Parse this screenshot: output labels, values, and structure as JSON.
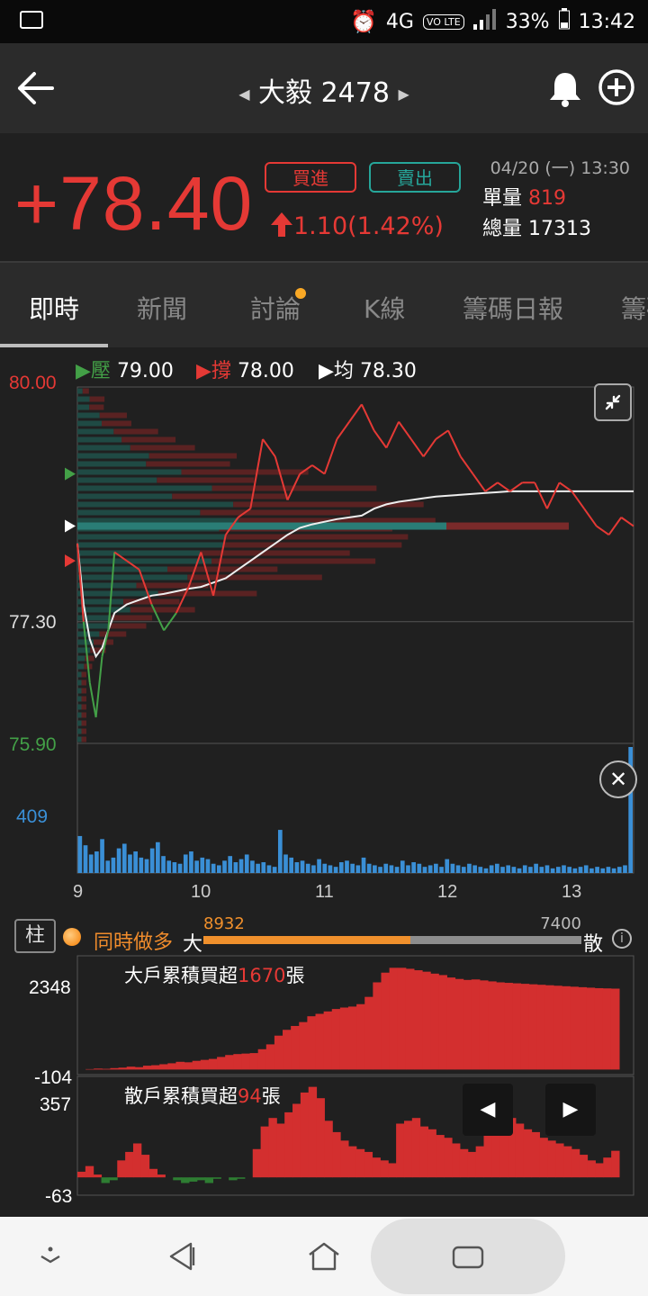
{
  "status_bar": {
    "network": "4G",
    "volte": "VO LTE",
    "battery": "33%",
    "time": "13:42"
  },
  "header": {
    "stock_name": "大毅 2478"
  },
  "quote": {
    "price": "78.40",
    "sign": "+",
    "buy_label": "買進",
    "sell_label": "賣出",
    "change": "1.10(1.42%)",
    "datetime": "04/20 (一) 13:30",
    "single_vol_label": "單量",
    "single_vol": "819",
    "total_vol_label": "總量",
    "total_vol": "17313"
  },
  "tabs": [
    {
      "label": "即時",
      "active": true
    },
    {
      "label": "新聞"
    },
    {
      "label": "討論",
      "has_dot": true
    },
    {
      "label": "K線"
    },
    {
      "label": "籌碼日報"
    },
    {
      "label": "籌碼"
    }
  ],
  "chart_legend": {
    "resist_label": "壓",
    "resist_value": "79.00",
    "support_label": "撐",
    "support_value": "78.00",
    "avg_label": "均",
    "avg_value": "78.30"
  },
  "chart_data": [
    {
      "type": "line",
      "y_top_label": "80.00",
      "y_mid_label": "77.30",
      "y_bottom_label": "75.90",
      "ylim": [
        75.9,
        80.0
      ],
      "x_tick_labels": [
        "9",
        "10",
        "11",
        "12",
        "13"
      ],
      "price_series_x": [
        9.0,
        9.05,
        9.1,
        9.15,
        9.2,
        9.25,
        9.3,
        9.4,
        9.5,
        9.6,
        9.7,
        9.8,
        9.9,
        10.0,
        10.1,
        10.2,
        10.3,
        10.4,
        10.5,
        10.6,
        10.7,
        10.8,
        10.9,
        11.0,
        11.1,
        11.2,
        11.3,
        11.4,
        11.5,
        11.6,
        11.7,
        11.8,
        11.9,
        12.0,
        12.1,
        12.2,
        12.3,
        12.4,
        12.5,
        12.6,
        12.7,
        12.8,
        12.9,
        13.0,
        13.1,
        13.2,
        13.3,
        13.4,
        13.5
      ],
      "price_series_y": [
        78.2,
        77.3,
        76.6,
        76.2,
        76.9,
        77.2,
        78.1,
        78.0,
        77.9,
        77.5,
        77.2,
        77.4,
        77.7,
        78.1,
        77.6,
        78.3,
        78.5,
        78.6,
        79.4,
        79.2,
        78.7,
        79.0,
        79.1,
        79.0,
        79.4,
        79.6,
        79.8,
        79.5,
        79.3,
        79.6,
        79.4,
        79.2,
        79.4,
        79.5,
        79.2,
        79.0,
        78.8,
        78.9,
        78.8,
        78.9,
        78.9,
        78.6,
        78.9,
        78.8,
        78.6,
        78.4,
        78.3,
        78.5,
        78.4
      ],
      "avg_series_y": [
        78.2,
        77.5,
        77.1,
        76.9,
        77.0,
        77.2,
        77.4,
        77.5,
        77.55,
        77.6,
        77.62,
        77.65,
        77.68,
        77.7,
        77.75,
        77.8,
        77.9,
        78.0,
        78.1,
        78.2,
        78.3,
        78.38,
        78.42,
        78.45,
        78.48,
        78.5,
        78.52,
        78.6,
        78.65,
        78.68,
        78.7,
        78.72,
        78.74,
        78.75,
        78.76,
        78.77,
        78.78,
        78.79,
        78.8,
        78.8,
        78.8,
        78.8,
        78.8,
        78.8,
        78.8,
        78.8,
        78.8,
        78.8,
        78.8
      ],
      "price_color": "#e53935",
      "below_color": "#43a047",
      "avg_color": "#eeeeee"
    },
    {
      "type": "bar",
      "volume_label": "409",
      "volume_color": "#3a8fd6",
      "values": [
        120,
        90,
        60,
        70,
        110,
        40,
        50,
        80,
        95,
        60,
        70,
        50,
        45,
        80,
        100,
        55,
        40,
        35,
        30,
        60,
        70,
        40,
        50,
        45,
        30,
        25,
        40,
        55,
        35,
        45,
        60,
        40,
        30,
        35,
        25,
        20,
        140,
        60,
        50,
        35,
        40,
        30,
        25,
        45,
        30,
        25,
        20,
        35,
        40,
        30,
        25,
        50,
        30,
        25,
        20,
        30,
        25,
        20,
        40,
        25,
        35,
        30,
        20,
        25,
        30,
        20,
        45,
        30,
        25,
        20,
        30,
        25,
        20,
        15,
        25,
        30,
        20,
        25,
        20,
        15,
        25,
        20,
        30,
        20,
        25,
        15,
        20,
        25,
        20,
        15,
        20,
        25,
        15,
        20,
        15,
        20,
        15,
        20,
        25,
        409
      ]
    },
    {
      "type": "area",
      "title_prefix": "大戶累積買超",
      "title_value": "1670",
      "title_suffix": "張",
      "y_top_label": "2348",
      "y_bottom_label": "-104",
      "ylim": [
        -104,
        2348
      ],
      "values": [
        0,
        10,
        20,
        15,
        30,
        40,
        60,
        50,
        80,
        90,
        110,
        130,
        160,
        150,
        180,
        200,
        220,
        260,
        300,
        320,
        330,
        340,
        420,
        520,
        700,
        820,
        900,
        980,
        1100,
        1150,
        1200,
        1250,
        1280,
        1300,
        1350,
        1500,
        1800,
        2000,
        2100,
        2100,
        2080,
        2050,
        2020,
        1980,
        1950,
        1900,
        1870,
        1850,
        1860,
        1840,
        1820,
        1800,
        1790,
        1780,
        1770,
        1760,
        1750,
        1740,
        1730,
        1720,
        1710,
        1700,
        1690,
        1680,
        1675,
        1670
      ],
      "fill_color": "#d32f2f"
    },
    {
      "type": "area",
      "title_prefix": "散戶累積買超",
      "title_value": "94",
      "title_suffix": "張",
      "y_top_label": "357",
      "y_bottom_label": "-63",
      "ylim": [
        -63,
        357
      ],
      "values": [
        20,
        40,
        10,
        -20,
        -10,
        60,
        90,
        120,
        80,
        30,
        10,
        0,
        -10,
        -20,
        -15,
        -10,
        -20,
        -5,
        0,
        -10,
        -5,
        0,
        100,
        180,
        210,
        190,
        230,
        260,
        300,
        320,
        280,
        200,
        160,
        130,
        110,
        100,
        90,
        70,
        60,
        50,
        190,
        200,
        210,
        180,
        170,
        150,
        140,
        120,
        100,
        90,
        110,
        150,
        180,
        200,
        210,
        190,
        170,
        160,
        140,
        130,
        120,
        110,
        100,
        80,
        60,
        50,
        70,
        94
      ],
      "fill_color": "#d32f2f",
      "neg_color": "#2e7d32"
    }
  ],
  "big_small": {
    "toggle_label": "柱",
    "mode_label": "同時做多",
    "big_label": "大",
    "small_label": "散",
    "big_value": "8932",
    "small_value": "7400",
    "info_label": "i"
  },
  "chart_nav": {
    "prev_icon": "◀",
    "next_icon": "▶"
  },
  "close_icon": "✕"
}
